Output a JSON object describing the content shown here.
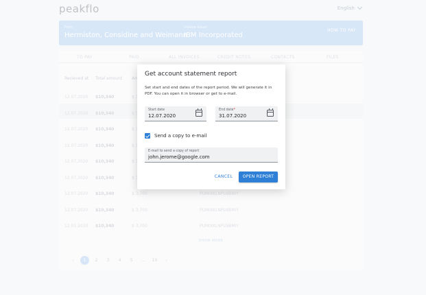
{
  "app": {
    "logo": "peakflo",
    "language": "English"
  },
  "banner": {
    "from_label": "From",
    "from_value": "Hermiston, Considine and Weimann",
    "invoice_label": "Invoice issuer",
    "invoice_value": "IBM Incorporated",
    "how_to_pay": "HOW TO PAY"
  },
  "tabs": [
    "TO PAY",
    "PAID",
    "ALL INVOICES",
    "CREDIT NOTES",
    "CONTACTS",
    "FILES"
  ],
  "table": {
    "headers": [
      "Recieved at",
      "Total amount",
      "Am"
    ],
    "rows": [
      {
        "date": "12.07.2020",
        "total": "$10,340",
        "amount": "$ 3",
        "ref": ""
      },
      {
        "date": "12.07.2020",
        "total": "$10,340",
        "amount": "$ 3",
        "ref": ""
      },
      {
        "date": "12.07.2020",
        "total": "$10,340",
        "amount": "$ 3",
        "ref": ""
      },
      {
        "date": "12.07.2020",
        "total": "$10,340",
        "amount": "$ 3",
        "ref": ""
      },
      {
        "date": "12.07.2020",
        "total": "$10,340",
        "amount": "$ 3",
        "ref": ""
      },
      {
        "date": "12.07.2020",
        "total": "$10,340",
        "amount": "$ 3",
        "ref": ""
      },
      {
        "date": "12.07.2020",
        "total": "$10,340",
        "amount": "$ 3,700",
        "ref": "PUMIXKLNPLNBMIY"
      },
      {
        "date": "12.07.2020",
        "total": "$10,340",
        "amount": "$ 3,700",
        "ref": "PUMIXKLNPLNBMIY"
      },
      {
        "date": "12.01.2020",
        "total": "$10,340",
        "amount": "$ 3,700",
        "ref": "PUMIXKLNPLNBMIY"
      }
    ],
    "show_more": "SHOW MORE"
  },
  "pagination": {
    "prev": "‹",
    "pages": [
      "1",
      "2",
      "3",
      "4",
      "5",
      "...",
      "10"
    ],
    "next": "›",
    "active_index": 0
  },
  "modal": {
    "title": "Get account statement report",
    "description": "Set start and end dates of the report period. We will generate it in PDF. You can open it in browser or get to e-mail.",
    "start_label": "Start date",
    "start_value": "12.07.2020",
    "end_label": "End date",
    "end_required": "*",
    "end_value": "31.07.2020",
    "checkbox_label": "Send a copy to e-mail",
    "checkbox_checked": true,
    "email_label": "E-mail to send a copy of report",
    "email_value": "john.jerome@google.com",
    "cancel": "CANCEL",
    "open": "OPEN REPORT"
  },
  "colors": {
    "accent": "#2e7fd6",
    "banner": "#b9d4f0"
  }
}
